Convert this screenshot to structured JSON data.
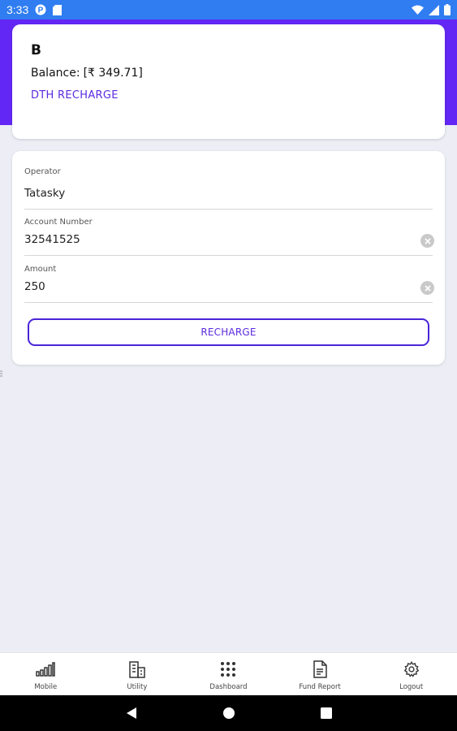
{
  "status_bar": {
    "time": "3:33",
    "left_icons": [
      "p-badge-icon",
      "sd-card-icon"
    ],
    "right_icons": [
      "wifi-icon",
      "signal-icon",
      "battery-icon"
    ],
    "color": "#2f7df1"
  },
  "header": {
    "color": "#6327f5"
  },
  "profile": {
    "name": "B",
    "balance_label": "Balance:",
    "balance_value": "[₹ 349.71]",
    "service_title": "DTH RECHARGE"
  },
  "form": {
    "operator": {
      "label": "Operator",
      "value": "Tatasky"
    },
    "account_number": {
      "label": "Account Number",
      "value": "32541525"
    },
    "amount": {
      "label": "Amount",
      "value": "250"
    },
    "submit_label": "RECHARGE"
  },
  "bottom_nav": {
    "items": [
      {
        "label": "Mobile",
        "icon": "signal-bars-icon"
      },
      {
        "label": "Utility",
        "icon": "building-icon"
      },
      {
        "label": "Dashboard",
        "icon": "grid-dots-icon"
      },
      {
        "label": "Fund Report",
        "icon": "document-icon"
      },
      {
        "label": "Logout",
        "icon": "gear-icon"
      }
    ]
  },
  "system_nav": {
    "buttons": [
      "back-icon",
      "home-icon",
      "recents-icon"
    ]
  },
  "colors": {
    "accent": "#5b2be0",
    "background": "#ecedf5"
  }
}
